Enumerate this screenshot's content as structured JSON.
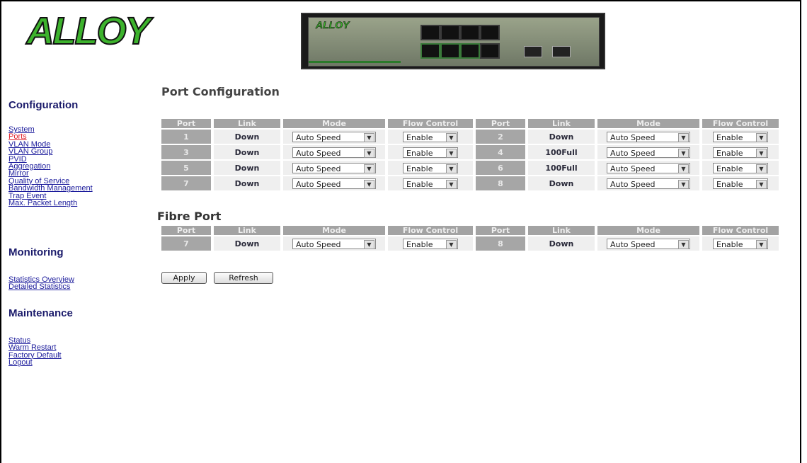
{
  "logo": {
    "text": "ALLOY"
  },
  "device": {
    "brand": "ALLOY"
  },
  "sidebar": {
    "configuration": {
      "heading": "Configuration",
      "items": [
        "System",
        "Ports",
        "VLAN Mode",
        "VLAN Group",
        "PVID",
        "Aggregation",
        "Mirror",
        "Quality of Service",
        "Bandwidth Management",
        "Trap Event",
        "Max. Packet Length"
      ],
      "active_index": 1
    },
    "monitoring": {
      "heading": "Monitoring",
      "items": [
        "Statistics Overview",
        "Detailed Statistics"
      ]
    },
    "maintenance": {
      "heading": "Maintenance",
      "items": [
        "Status",
        "Warm Restart",
        "Factory Default",
        "Logout"
      ]
    }
  },
  "main": {
    "title": "Port Configuration",
    "headers": [
      "Port",
      "Link",
      "Mode",
      "Flow Control",
      "Port",
      "Link",
      "Mode",
      "Flow Control"
    ],
    "ports": [
      {
        "port": "1",
        "link": "Down",
        "mode": "Auto Speed",
        "flow": "Enable"
      },
      {
        "port": "2",
        "link": "Down",
        "mode": "Auto Speed",
        "flow": "Enable"
      },
      {
        "port": "3",
        "link": "Down",
        "mode": "Auto Speed",
        "flow": "Enable"
      },
      {
        "port": "4",
        "link": "100Full",
        "mode": "Auto Speed",
        "flow": "Enable"
      },
      {
        "port": "5",
        "link": "Down",
        "mode": "Auto Speed",
        "flow": "Enable"
      },
      {
        "port": "6",
        "link": "100Full",
        "mode": "Auto Speed",
        "flow": "Enable"
      },
      {
        "port": "7",
        "link": "Down",
        "mode": "Auto Speed",
        "flow": "Enable"
      },
      {
        "port": "8",
        "link": "Down",
        "mode": "Auto Speed",
        "flow": "Enable"
      }
    ],
    "fibre": {
      "title": "Fibre Port",
      "ports": [
        {
          "port": "7",
          "link": "Down",
          "mode": "Auto Speed",
          "flow": "Enable"
        },
        {
          "port": "8",
          "link": "Down",
          "mode": "Auto Speed",
          "flow": "Enable"
        }
      ]
    },
    "buttons": {
      "apply": "Apply",
      "refresh": "Refresh"
    }
  },
  "colors": {
    "link": "#1c1c9c",
    "active_link": "#e0202a",
    "heading": "#1b1b6b",
    "header_bg": "#a3a3a3",
    "cell_bg": "#efefef",
    "logo_green": "#3db32d"
  },
  "icons": {
    "select_arrow": "chevron-down-icon"
  }
}
